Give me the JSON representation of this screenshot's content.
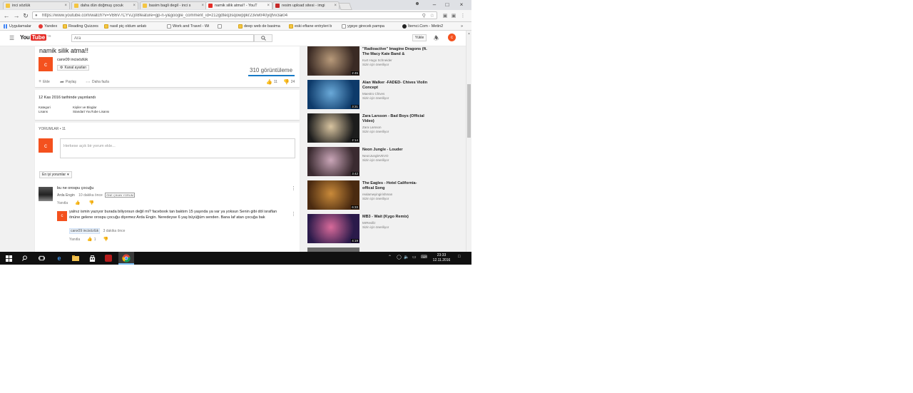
{
  "browser": {
    "tabs": [
      {
        "title": "inci sözlük",
        "favicon_color": "#f4c542"
      },
      {
        "title": "daha dün doğmuş çocuk",
        "favicon_color": "#f4c542"
      },
      {
        "title": "basim bagli degil - inci s",
        "favicon_color": "#f4c542"
      },
      {
        "title": "namik silik atma!! - YouT",
        "favicon_color": "#e52d27"
      },
      {
        "title": "resim upload sitesi - imgi",
        "favicon_color": "#c62828"
      }
    ],
    "url": "https://www.youtube.com/watch?v=VB6V7CYVZj08feature=gp-n-y&google_comment_id=z12gdteq3sqowppkr23vwtr40yqfvv3ai04",
    "bookmarks": [
      {
        "label": "Uygulamalar",
        "type": "apps"
      },
      {
        "label": "Yandex",
        "type": "yandex"
      },
      {
        "label": "Reading Quizzes",
        "type": "folder"
      },
      {
        "label": "nasil piç oldum anlatı",
        "type": "page"
      },
      {
        "label": "Work and Travel - Wi",
        "type": "page"
      },
      {
        "label": "",
        "type": "page"
      },
      {
        "label": "deep web de basima",
        "type": "folder"
      },
      {
        "label": "eski eftane entryleri b",
        "type": "folder"
      },
      {
        "label": "ygsye girecek pampa",
        "type": "folder"
      },
      {
        "label": "İtemci.Com - Metin2",
        "type": "itemci"
      }
    ]
  },
  "youtube": {
    "logo_you": "You",
    "logo_tube": "Tube",
    "logo_tr": "TR",
    "search_placeholder": "Ara",
    "upload_label": "Yükle",
    "avatar_letter": "c"
  },
  "video": {
    "title": "namik silik atma!!",
    "channel": "canx09 incisözlük",
    "channel_button": "Kanal ayarları",
    "views": "310 görüntüleme",
    "add_label": "Ekle",
    "share_label": "Paylaş",
    "more_label": "Daha fazla",
    "likes": "11",
    "dislikes": "24",
    "published": "12 Kas 2016 tarihinde yayınlandı",
    "category_label": "Kategori",
    "category_value": "Kişiler ve Bloglar",
    "license_label": "Lisans",
    "license_value": "Standart YouTube Lisansı"
  },
  "comments": {
    "header": "YORUMLAR • 11",
    "placeholder": "Herkese açık bir yorum ekle...",
    "sort_label": "En iyi yorumlar",
    "items": [
      {
        "text": "bu ne orospu çocuğu",
        "author": "Arda Engin",
        "time": "10 dakika önce",
        "badge": "ÖNE ÇIKAN YORUM",
        "reply_label": "Yanıtla",
        "likes": ""
      },
      {
        "text": "yalnız ismin yazıyor burada biliyorsun değil mi? facebook tan baktım 15 yaşında ya var ya yoksun  Senin gibi döl israflan önüne gelene orospu çocuğu diyemez Arda Engin. Neredeyse 6 yaş büyüğüm senden. Bana laf atan çocuğa bak",
        "author": "canx09 incisözlük",
        "time": "3 dakika önce",
        "reply_label": "Yanıtla",
        "likes": "1",
        "avatar_letter": "c"
      }
    ]
  },
  "recommendations": [
    {
      "title": "\"Radioactive\" Imagine Dragons (ft. The Macy Kate Band &",
      "channel": "Kurt Hugo Schneider",
      "suggest": "Sizin için öneriliyor",
      "duration": "2:45",
      "thumb": [
        "#3a2a24",
        "#b89a7a"
      ]
    },
    {
      "title": "Alan Walker -FADED- Chives Violin Concept",
      "channel": "Maestro Chives",
      "suggest": "Sizin için öneriliyor",
      "duration": "3:31",
      "thumb": [
        "#0d3a6a",
        "#6aa9d8"
      ]
    },
    {
      "title": "Zara Larsson - Bad Boys (Official Video)",
      "channel": "Zara Larsson",
      "suggest": "Sizin için öneriliyor",
      "duration": "2:14",
      "thumb": [
        "#1c1c1c",
        "#d8c4a0"
      ]
    },
    {
      "title": "Neon Jungle - Louder",
      "channel": "NeonJungleVEVO",
      "suggest": "Sizin için öneriliyor",
      "duration": "3:42",
      "thumb": [
        "#3a2a30",
        "#caa6b8"
      ]
    },
    {
      "title": "The Eagles - Hotel California- offical Song",
      "channel": "realamwyingirishman",
      "suggest": "Sizin için öneriliyor",
      "duration": "6:33",
      "thumb": [
        "#4a2a10",
        "#c98a3a"
      ]
    },
    {
      "title": "MB3 - Wait (Kygo Remix)",
      "channel": "MrRevillz",
      "suggest": "Sizin için öneriliyor",
      "duration": "4:19",
      "thumb": [
        "#2a1a4a",
        "#d86a9a"
      ]
    }
  ],
  "taskbar": {
    "time": "23:33",
    "date": "12.11.2016"
  }
}
